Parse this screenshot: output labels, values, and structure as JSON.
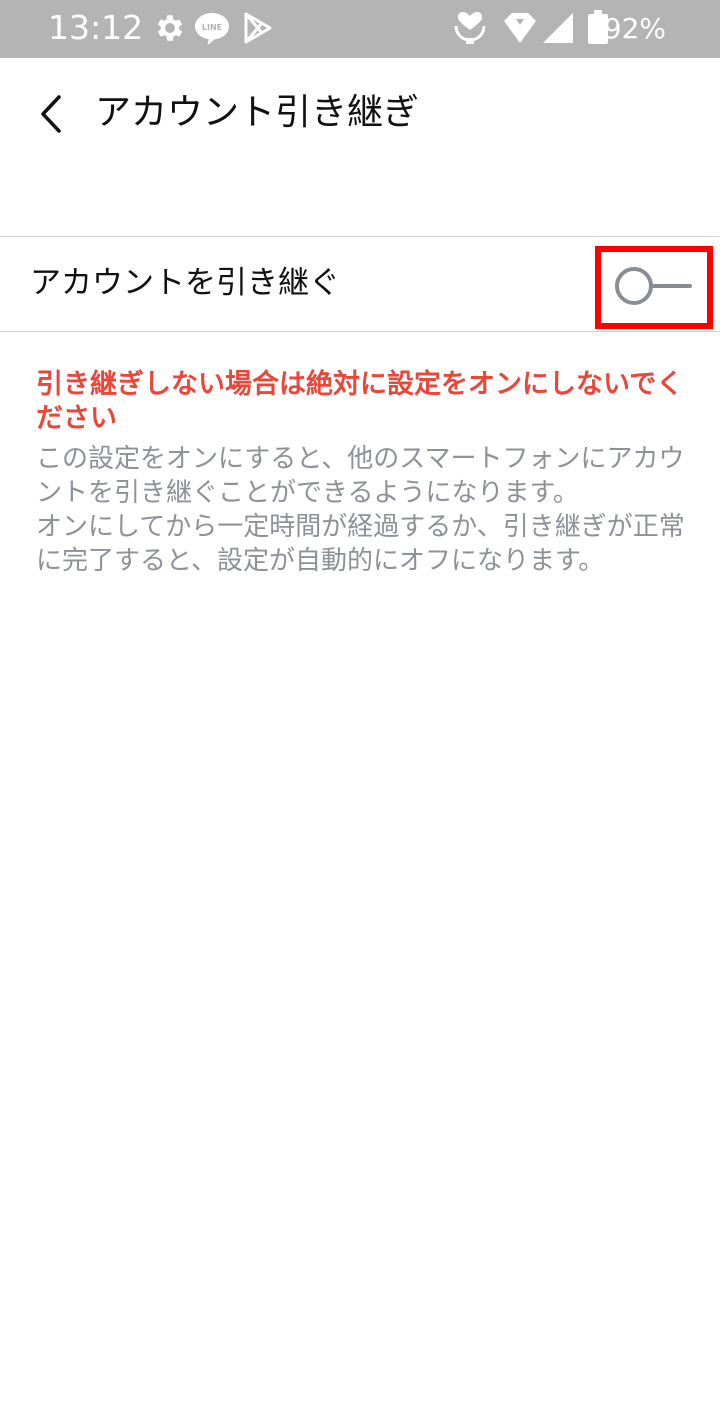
{
  "status_bar": {
    "time": "13:12",
    "battery_percent": "92%",
    "left_icons": [
      "gear-icon",
      "line-app-icon",
      "play-store-icon"
    ],
    "right_icons": [
      "heart-hand-icon",
      "wifi-icon",
      "signal-icon",
      "battery-icon"
    ],
    "background": "#b4b4b4"
  },
  "header": {
    "title": "アカウント引き継ぎ",
    "back_icon": "chevron-left-icon"
  },
  "setting": {
    "label": "アカウントを引き継ぐ",
    "toggle_state": "off",
    "highlight_color": "#ff0000"
  },
  "notice": {
    "warning": "引き継ぎしない場合は絶対に設定をオンにしないでください",
    "description": "この設定をオンにすると、他のスマートフォンにアカウントを引き継ぐことができるようになります。\nオンにしてから一定時間が経過するか、引き継ぎが正常に完了すると、設定が自動的にオフになります。",
    "warning_color": "#e8473a",
    "description_color": "#8e9198"
  }
}
